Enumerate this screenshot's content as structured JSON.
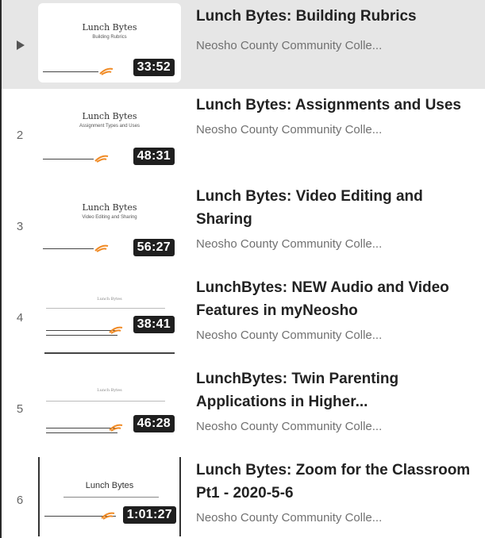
{
  "playlist": {
    "items": [
      {
        "index": "",
        "active": true,
        "thumb_title": "Lunch Bytes",
        "thumb_subtitle": "Building Rubrics",
        "duration": "33:52",
        "title": "Lunch Bytes: Building Rubrics",
        "channel": "Neosho County Community Colle..."
      },
      {
        "index": "2",
        "thumb_title": "Lunch Bytes",
        "thumb_subtitle": "Assignment Types and Uses",
        "duration": "48:31",
        "title": "Lunch Bytes: Assignments and Uses",
        "channel": "Neosho County Community Colle..."
      },
      {
        "index": "3",
        "thumb_title": "Lunch Bytes",
        "thumb_subtitle": "Video Editing and Sharing",
        "duration": "56:27",
        "title": "Lunch Bytes: Video Editing and Sharing",
        "channel": "Neosho County Community Colle..."
      },
      {
        "index": "4",
        "thumb_title": "Lunch Bytes",
        "thumb_subtitle": "",
        "duration": "38:41",
        "title": "LunchBytes: NEW Audio and Video Features in myNeosho",
        "channel": "Neosho County Community Colle..."
      },
      {
        "index": "5",
        "thumb_title": "Lunch Bytes",
        "thumb_subtitle": "",
        "duration": "46:28",
        "title": "LunchBytes: Twin Parenting Applications in Higher...",
        "channel": "Neosho County Community Colle..."
      },
      {
        "index": "6",
        "thumb_title": "Lunch Bytes",
        "thumb_subtitle": "",
        "duration": "1:01:27",
        "title": "Lunch Bytes: Zoom for the Classroom Pt1 - 2020-5-6",
        "channel": "Neosho County Community Colle..."
      }
    ],
    "icons": {
      "now_playing": "play-triangle-icon"
    },
    "colors": {
      "active_row": "#e6e6e6",
      "duration_badge": "#1f1f1f",
      "accent_swoosh": "#f08a24"
    }
  }
}
